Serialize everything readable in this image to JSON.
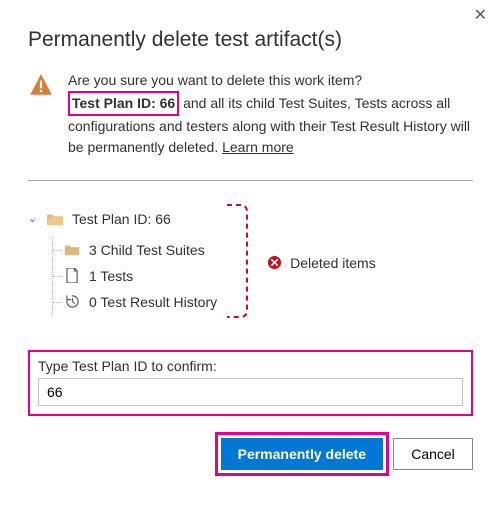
{
  "dialog": {
    "title": "Permanently delete test artifact(s)",
    "message_part1": "Are you sure you want to delete this work item?",
    "highlighted_id": "Test Plan ID: 66",
    "message_part2": " and all its child Test Suites, Tests across all configurations and testers along with their Test Result History will be permanently deleted. ",
    "learn_more": "Learn more"
  },
  "tree": {
    "root": "Test Plan ID: 66",
    "items": [
      {
        "label": "3 Child Test Suites"
      },
      {
        "label": "1 Tests"
      },
      {
        "label": "0 Test Result History"
      }
    ]
  },
  "deleted_label": "Deleted items",
  "confirm": {
    "label": "Type Test Plan ID to confirm:",
    "value": "66"
  },
  "buttons": {
    "primary": "Permanently delete",
    "cancel": "Cancel"
  }
}
